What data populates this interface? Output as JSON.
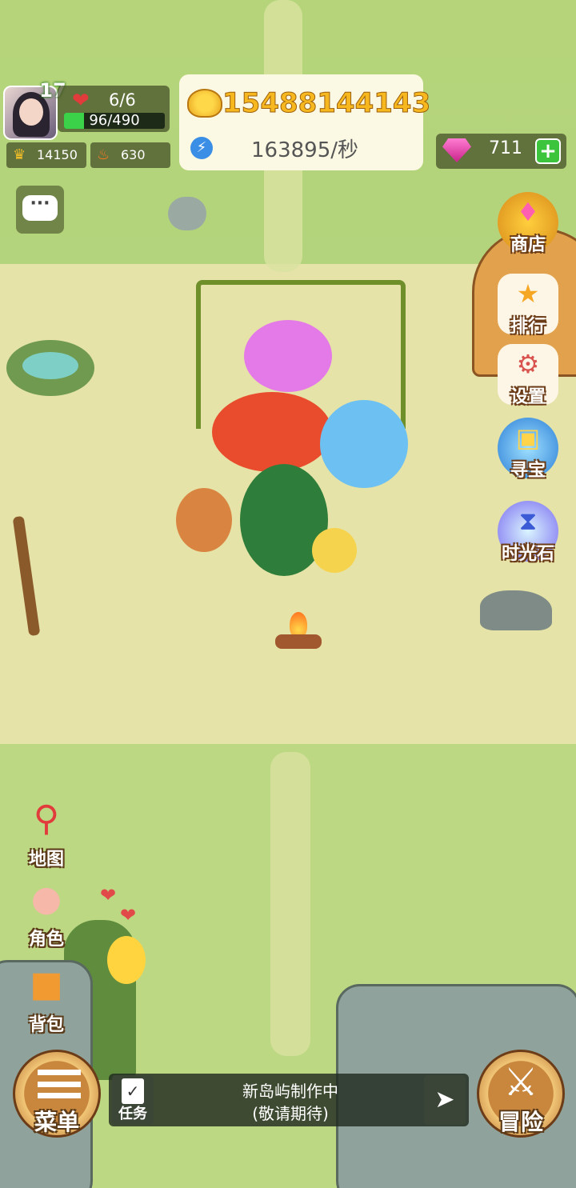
{
  "player": {
    "level": "17",
    "hp": "6/6",
    "exp": "96/490",
    "exp_fraction": 0.196,
    "crowns": "14150",
    "fire": "630"
  },
  "currency": {
    "gold": "15488144143",
    "rate": "163895/秒",
    "gems": "711"
  },
  "side_menu": {
    "shop": "商店",
    "rank": "排行",
    "settings": "设置",
    "treasure": "寻宝",
    "time_stone": "时光石"
  },
  "left_menu": {
    "map": "地图",
    "role": "角色",
    "bag": "背包"
  },
  "bottom": {
    "menu": "菜单",
    "task": "任务",
    "task_title": "新岛屿制作中",
    "task_subtitle": "(敬请期待)",
    "adventure": "冒险"
  },
  "icons": {
    "heart": "heart-icon",
    "crown": "crown-icon",
    "fire": "fire-icon",
    "gold": "gold-ingot-icon",
    "energy": "lightning-icon",
    "gem": "gem-icon",
    "chat": "chat-icon"
  },
  "colors": {
    "exp_bar": "#3bd24a",
    "gold_text": "#f6b81e",
    "gem": "#e03aa8",
    "add_button": "#3cc43c"
  }
}
